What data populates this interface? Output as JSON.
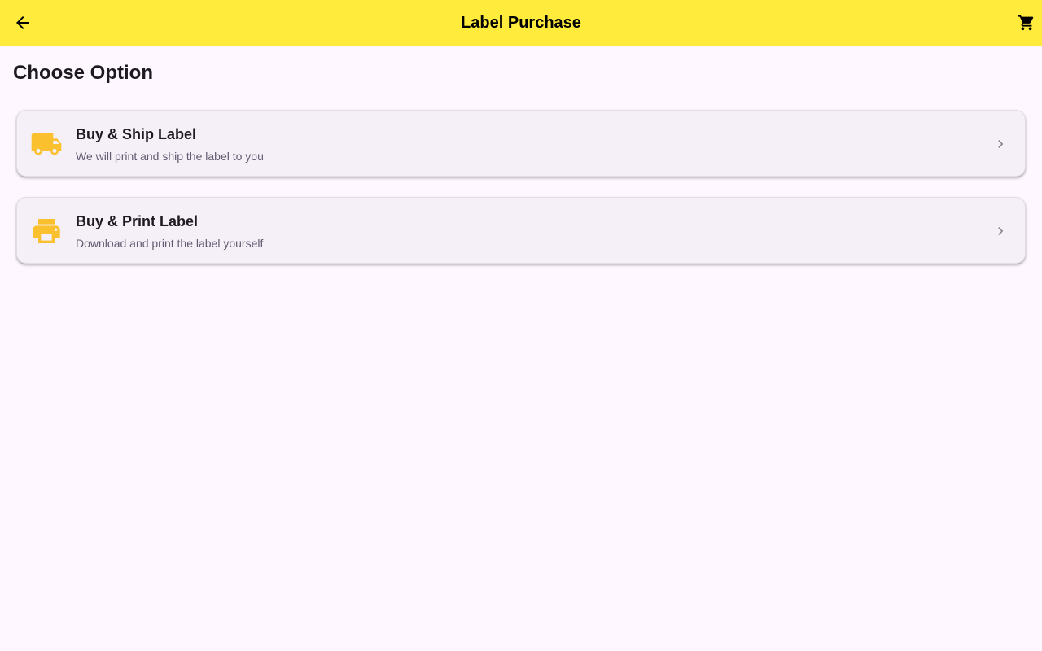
{
  "app_bar": {
    "title": "Label Purchase",
    "back_icon": "arrow-back-icon",
    "cart_icon": "shopping-cart-icon",
    "background_color": "#ffeb3b"
  },
  "page": {
    "heading": "Choose Option",
    "background_color": "#fef7ff"
  },
  "options": [
    {
      "title": "Buy & Ship Label",
      "subtitle": "We will print and ship the label to you",
      "icon": "truck-icon",
      "chevron_icon": "chevron-right-icon"
    },
    {
      "title": "Buy & Print Label",
      "subtitle": "Download and print the label yourself",
      "icon": "printer-icon",
      "chevron_icon": "chevron-right-icon"
    }
  ],
  "colors": {
    "icon_accent": "#fbc02d",
    "card_background": "#f5eff7",
    "subtitle_text": "#625b71",
    "chevron": "#8a8a8a"
  }
}
